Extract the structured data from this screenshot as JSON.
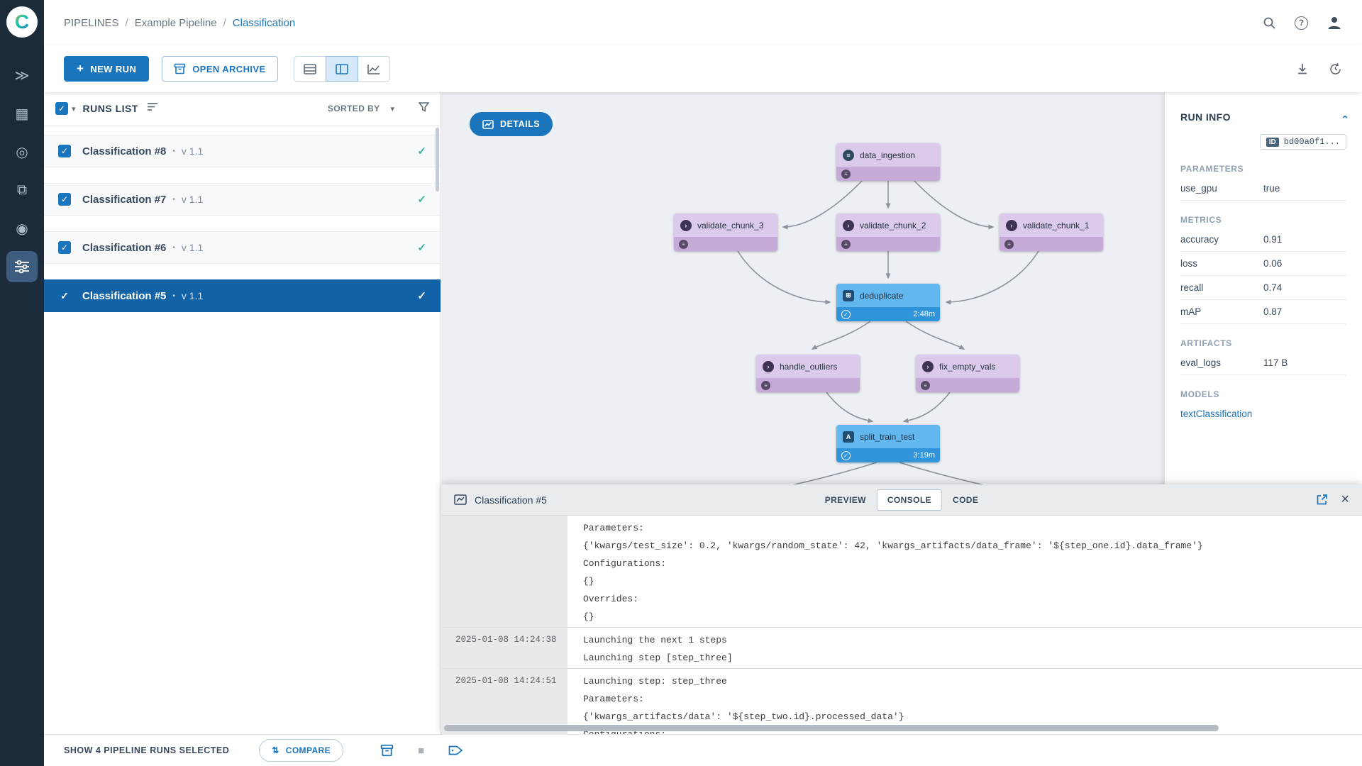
{
  "colors": {
    "accent": "#1b75bc",
    "rail_bg": "#1c2b39",
    "selected_run_bg": "#1262a8",
    "node_purple": "#dccaec",
    "node_purple_foot": "#c6abd8",
    "node_blue": "#62b7ef",
    "node_blue_foot": "#2f94da",
    "success_check": "#36b79c"
  },
  "icons": {
    "plus": "+",
    "caret_down": "▾",
    "check": "✓",
    "close": "×",
    "chevron": "›",
    "bullet": "•",
    "menu": "≡",
    "grid_plus": "⊞",
    "double_chevron": "≫",
    "grid": "▦",
    "target": "◎",
    "stack": "⧉",
    "sphere": "◉",
    "question": "?",
    "compare": "⇅",
    "stop": "■",
    "letter_a": "A",
    "slash": "/"
  },
  "breadcrumb": {
    "root": "PIPELINES",
    "project": "Example Pipeline",
    "current": "Classification"
  },
  "toolbar": {
    "new_run_label": "NEW RUN",
    "open_archive_label": "OPEN ARCHIVE"
  },
  "runs_panel": {
    "title": "RUNS LIST",
    "sorted_by_label": "SORTED BY",
    "runs": [
      {
        "name": "Classification #8",
        "version": "v 1.1"
      },
      {
        "name": "Classification #7",
        "version": "v 1.1"
      },
      {
        "name": "Classification #6",
        "version": "v 1.1"
      },
      {
        "name": "Classification #5",
        "version": "v 1.1"
      }
    ]
  },
  "graph": {
    "details_label": "DETAILS",
    "nodes": [
      {
        "label": "data_ingestion",
        "duration": ""
      },
      {
        "label": "validate_chunk_3",
        "duration": ""
      },
      {
        "label": "validate_chunk_2",
        "duration": ""
      },
      {
        "label": "validate_chunk_1",
        "duration": ""
      },
      {
        "label": "deduplicate",
        "duration": "2:48m"
      },
      {
        "label": "handle_outliers",
        "duration": ""
      },
      {
        "label": "fix_empty_vals",
        "duration": ""
      },
      {
        "label": "split_train_test",
        "duration": "3:19m"
      }
    ]
  },
  "run_info": {
    "title": "RUN INFO",
    "id_badge": "ID",
    "id_value": "bd00a0f1...",
    "sections": {
      "parameters": {
        "title": "PARAMETERS",
        "rows": [
          {
            "k": "use_gpu",
            "v": "true"
          }
        ]
      },
      "metrics": {
        "title": "METRICS",
        "rows": [
          {
            "k": "accuracy",
            "v": "0.91"
          },
          {
            "k": "loss",
            "v": "0.06"
          },
          {
            "k": "recall",
            "v": "0.74"
          },
          {
            "k": "mAP",
            "v": "0.87"
          }
        ]
      },
      "artifacts": {
        "title": "ARTIFACTS",
        "rows": [
          {
            "k": "eval_logs",
            "v": "117 B"
          }
        ]
      },
      "models": {
        "title": "MODELS",
        "rows": [
          {
            "k": "textClassification",
            "v": ""
          }
        ]
      }
    }
  },
  "console": {
    "title": "Classification #5",
    "tabs": {
      "preview": "PREVIEW",
      "console": "CONSOLE",
      "code": "CODE"
    },
    "entries": [
      {
        "timestamp": "",
        "lines": [
          "Parameters:",
          "{'kwargs/test_size': 0.2, 'kwargs/random_state': 42, 'kwargs_artifacts/data_frame': '${step_one.id}.data_frame'}",
          "Configurations:",
          "{}",
          "Overrides:",
          "{}"
        ]
      },
      {
        "timestamp": "2025-01-08 14:24:38",
        "lines": [
          "Launching the next 1 steps",
          "Launching step [step_three]"
        ]
      },
      {
        "timestamp": "2025-01-08 14:24:51",
        "lines": [
          "Launching step: step_three",
          "Parameters:",
          "{'kwargs_artifacts/data': '${step_two.id}.processed_data'}",
          "Configurations:"
        ]
      }
    ]
  },
  "statusbar": {
    "selected_text": "SHOW 4 PIPELINE RUNS SELECTED",
    "compare_label": "COMPARE"
  }
}
